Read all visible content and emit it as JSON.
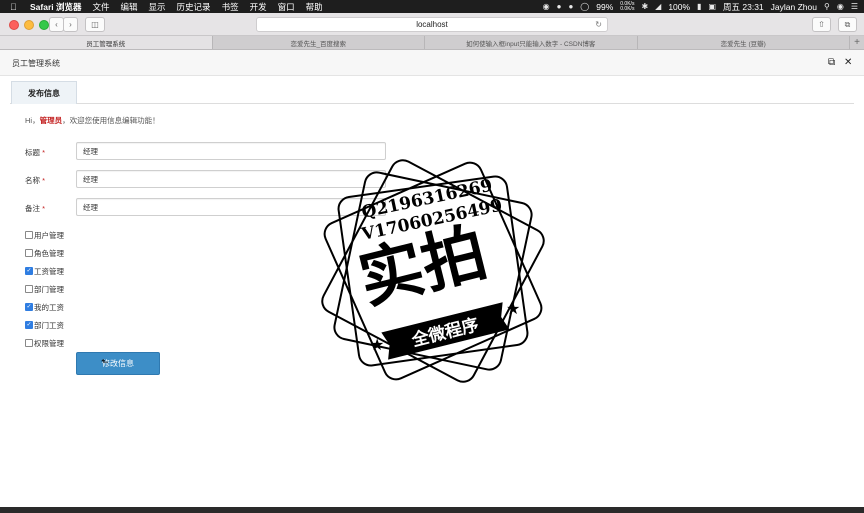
{
  "menubar": {
    "app_name": "Safari 浏览器",
    "items": [
      "文件",
      "编辑",
      "显示",
      "历史记录",
      "书签",
      "开发",
      "窗口",
      "帮助"
    ],
    "battery": "99%",
    "net_up": "0.0K/s",
    "net_down": "0.0K/s",
    "battery2": "100%",
    "clock": "周五 23:31",
    "user": "Jaylan Zhou"
  },
  "browser": {
    "address": "localhost",
    "tabs": [
      {
        "label": "员工管理系统",
        "active": true
      },
      {
        "label": "恋爱先生_百度搜索",
        "active": false
      },
      {
        "label": "如何使输入框input只能输入数字 - CSDN博客",
        "active": false
      },
      {
        "label": "恋爱先生 (豆瓣)",
        "active": false
      }
    ],
    "new_tab": "+"
  },
  "app": {
    "title": "员工管理系统"
  },
  "page": {
    "tab_label": "发布信息",
    "greeting_prefix": "Hi，",
    "role": "管理员",
    "greeting_suffix": "，欢迎您使用信息编辑功能！",
    "fields": [
      {
        "label": "标题",
        "required": "*",
        "value": "经理"
      },
      {
        "label": "名称",
        "required": "*",
        "value": "经理"
      },
      {
        "label": "备注",
        "required": "*",
        "value": "经理"
      }
    ],
    "checkboxes": [
      {
        "label": "用户管理",
        "checked": false
      },
      {
        "label": "角色管理",
        "checked": false
      },
      {
        "label": "工资管理",
        "checked": true
      },
      {
        "label": "部门管理",
        "checked": false
      },
      {
        "label": "我的工资",
        "checked": true
      },
      {
        "label": "部门工资",
        "checked": true
      },
      {
        "label": "权限管理",
        "checked": false
      }
    ],
    "submit_label": "修改信息"
  },
  "watermark": {
    "line1": "Q2196316269",
    "line2": "V17060256499",
    "main": "实拍",
    "banner": "全微程序"
  },
  "colors": {
    "accent": "#3d8ec7",
    "required": "#c21e1e",
    "checked": "#2f7de1"
  }
}
